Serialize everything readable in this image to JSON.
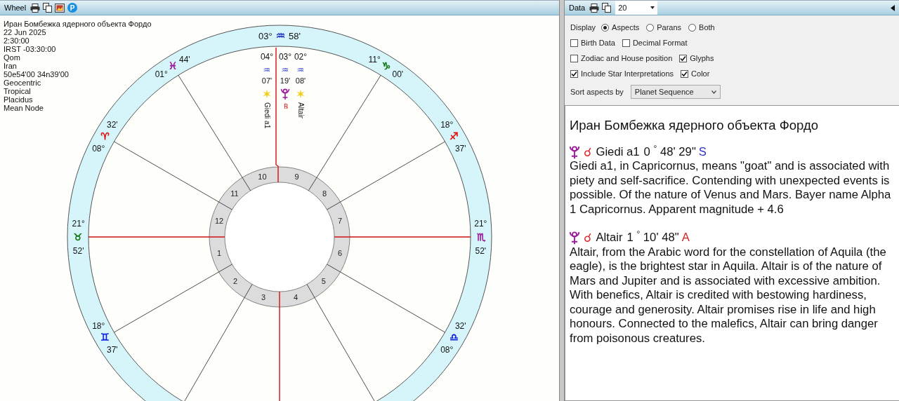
{
  "wheel_panel": {
    "title": "Wheel",
    "toolbar_letter": "P"
  },
  "chart_info": [
    "Иран Бомбежка ядерного объекта Фордо",
    "22 Jun 2025",
    "2:30:00",
    "IRST -03:30:00",
    "Qom",
    "Iran",
    "50e54'00 34n39'00",
    "Geocentric",
    "Tropical",
    "Placidus",
    "Mean Node"
  ],
  "wheel": {
    "houses": [
      {
        "number": "10",
        "cusp": {
          "kind": "inline",
          "color": "#2233cc",
          "lines": [
            {
              "kind": "degree",
              "text": "03°"
            },
            {
              "kind": "sign",
              "text": "♒"
            },
            {
              "kind": "minute",
              "text": "58'"
            }
          ]
        }
      },
      {
        "number": "11",
        "cusp": {
          "kind": "stacked",
          "color": "#9b1b9b",
          "lines": [
            {
              "kind": "minute",
              "text": "44'"
            },
            {
              "kind": "sign",
              "text": "♓"
            },
            {
              "kind": "degree",
              "text": "01°"
            }
          ]
        }
      },
      {
        "number": "9",
        "cusp": {
          "kind": "stacked",
          "color": "#117711",
          "lines": [
            {
              "kind": "degree",
              "text": "11°"
            },
            {
              "kind": "sign",
              "text": "♑"
            },
            {
              "kind": "minute",
              "text": "00'"
            }
          ]
        }
      },
      {
        "number": "12",
        "cusp": {
          "kind": "stacked",
          "color": "#dd1111",
          "lines": [
            {
              "kind": "minute",
              "text": "32'"
            },
            {
              "kind": "sign",
              "text": "♈"
            },
            {
              "kind": "degree",
              "text": "08°"
            }
          ]
        }
      },
      {
        "number": "8",
        "cusp": {
          "kind": "stacked",
          "color": "#dd1111",
          "lines": [
            {
              "kind": "degree",
              "text": "18°"
            },
            {
              "kind": "sign",
              "text": "♐"
            },
            {
              "kind": "minute",
              "text": "37'"
            }
          ]
        }
      },
      {
        "number": "1",
        "cusp": {
          "kind": "stacked",
          "color": "#117711",
          "lines": [
            {
              "kind": "degree",
              "text": "21°"
            },
            {
              "kind": "sign",
              "text": "♉"
            },
            {
              "kind": "minute",
              "text": "52'"
            }
          ]
        }
      },
      {
        "number": "7",
        "cusp": {
          "kind": "stacked",
          "color": "#9b1b9b",
          "lines": [
            {
              "kind": "degree",
              "text": "21°"
            },
            {
              "kind": "sign",
              "text": "♏"
            },
            {
              "kind": "minute",
              "text": "52'"
            }
          ]
        }
      },
      {
        "number": "2",
        "cusp": {
          "kind": "stacked",
          "color": "#1122dd",
          "lines": [
            {
              "kind": "degree",
              "text": "18°"
            },
            {
              "kind": "sign",
              "text": "♊"
            },
            {
              "kind": "minute",
              "text": "37'"
            }
          ]
        }
      },
      {
        "number": "6",
        "cusp": {
          "kind": "stacked",
          "color": "#1122dd",
          "lines": [
            {
              "kind": "minute",
              "text": "32'"
            },
            {
              "kind": "sign",
              "text": "♎"
            },
            {
              "kind": "degree",
              "text": "08°"
            }
          ]
        }
      },
      {
        "number": "5"
      },
      {
        "number": "3"
      },
      {
        "number": "4"
      }
    ],
    "objects": [
      {
        "kind": "star",
        "degree": "04°",
        "sign": "♒",
        "minute": "07'",
        "name": "Giedi a1"
      },
      {
        "kind": "pluto",
        "degree": "03°",
        "sign": "♒",
        "minute": "19'",
        "retrograde_mark": "℞"
      },
      {
        "kind": "star",
        "degree": "02°",
        "sign": "♒",
        "minute": "08'",
        "name": "Altair"
      }
    ]
  },
  "data_panel": {
    "title": "Data",
    "count_select": "20",
    "display_label": "Display",
    "display_options": [
      {
        "label": "Aspects",
        "selected": true
      },
      {
        "label": "Parans",
        "selected": false
      },
      {
        "label": "Both",
        "selected": false
      }
    ],
    "option_rows": [
      [
        {
          "label": "Birth Data",
          "checked": false
        },
        {
          "label": "Decimal Format",
          "checked": false
        }
      ],
      [
        {
          "label": "Zodiac and House position",
          "checked": false
        },
        {
          "label": "Glyphs",
          "checked": true
        }
      ],
      [
        {
          "label": "Include Star Interpretations",
          "checked": true
        },
        {
          "label": "Color",
          "checked": true
        }
      ]
    ],
    "sort_label": "Sort aspects by",
    "sort_value": "Planet Sequence"
  },
  "report": {
    "title": "Иран Бомбежка ядерного объекта Фордо",
    "entries": [
      {
        "kind": "pluto",
        "aspect": "☌",
        "star": "Giedi a1",
        "orb": "0 $^{°}$ 48' 29\"",
        "motion": "S",
        "color": "#3333cc",
        "text": "Giedi a1, in Capricornus, means \"goat\" and is associated with piety and self-sacrifice. Contending with unexpected events is possible. Of the nature of Venus and Mars. Bayer name Alpha 1 Capricornus. Apparent magnitude + 4.6"
      },
      {
        "kind": "pluto",
        "aspect": "☌",
        "star": "Altair",
        "orb": "1 $^{°}$ 10' 48\"",
        "motion": "A",
        "color": "#dd2222",
        "text": "Altair, from the Arabic word for the constellation of Aquila (the eagle), is the brightest star in Aquila. Altair is of the nature of Mars and Jupiter and is associated with excessive ambition. With benefics, Altair is credited with bestowing hardiness, courage and generosity. Altair promises rise in life and high honours. Connected to the malefics, Altair can bring danger from poisonous creatures."
      }
    ]
  }
}
